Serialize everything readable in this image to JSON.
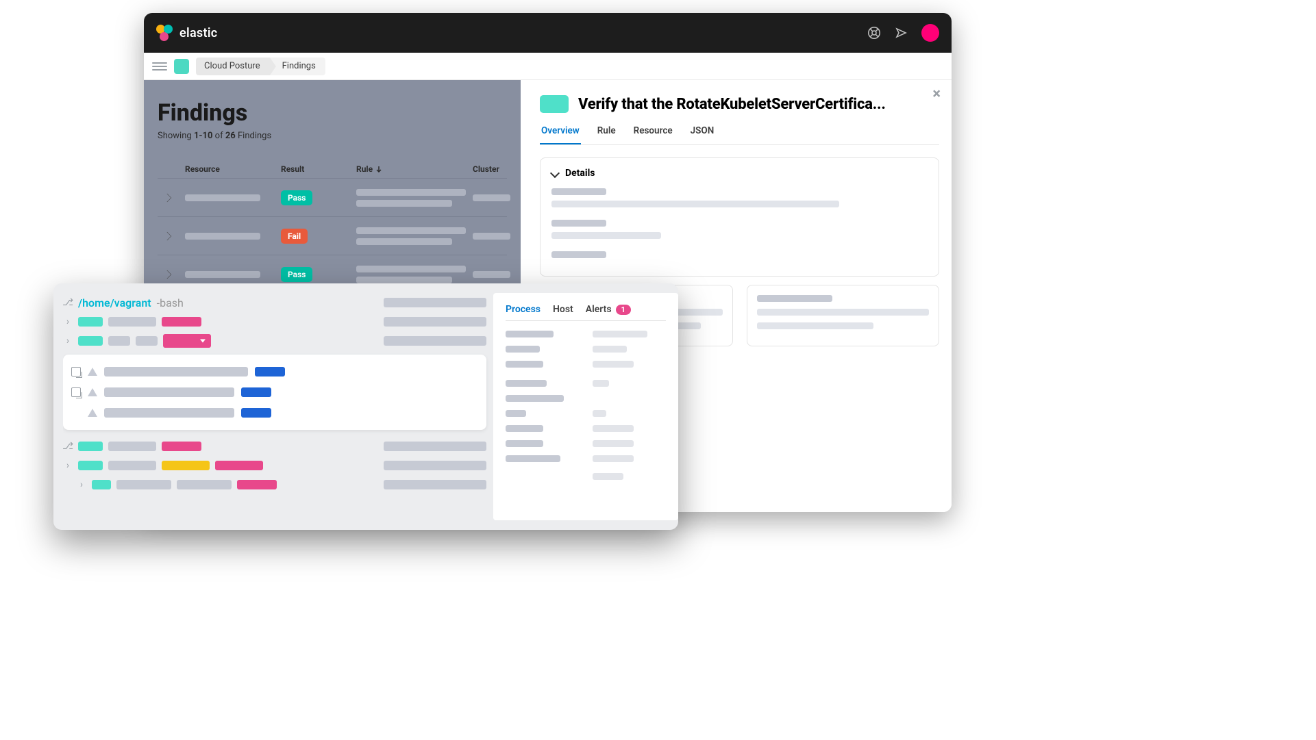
{
  "brand": {
    "name": "elastic"
  },
  "breadcrumbs": {
    "items": [
      "Cloud Posture",
      "Findings"
    ]
  },
  "page": {
    "title": "Findings",
    "subtitle_prefix": "Showing ",
    "subtitle_range": "1-10",
    "subtitle_mid": " of ",
    "subtitle_total": "26",
    "subtitle_suffix": " Findings"
  },
  "columns": {
    "resource": "Resource",
    "result": "Result",
    "rule": "Rule",
    "cluster": "Cluster"
  },
  "rows": [
    {
      "result": "Pass"
    },
    {
      "result": "Fail"
    },
    {
      "result": "Pass"
    }
  ],
  "flyout": {
    "title": "Verify that the RotateKubeletServerCertifica...",
    "tabs": [
      "Overview",
      "Rule",
      "Resource",
      "JSON"
    ],
    "details_heading": "Details"
  },
  "terminal": {
    "path": "/home/vagrant",
    "shell": "-bash"
  },
  "overlay_tabs": {
    "items": [
      "Process",
      "Host",
      "Alerts"
    ],
    "alert_count": "1"
  }
}
